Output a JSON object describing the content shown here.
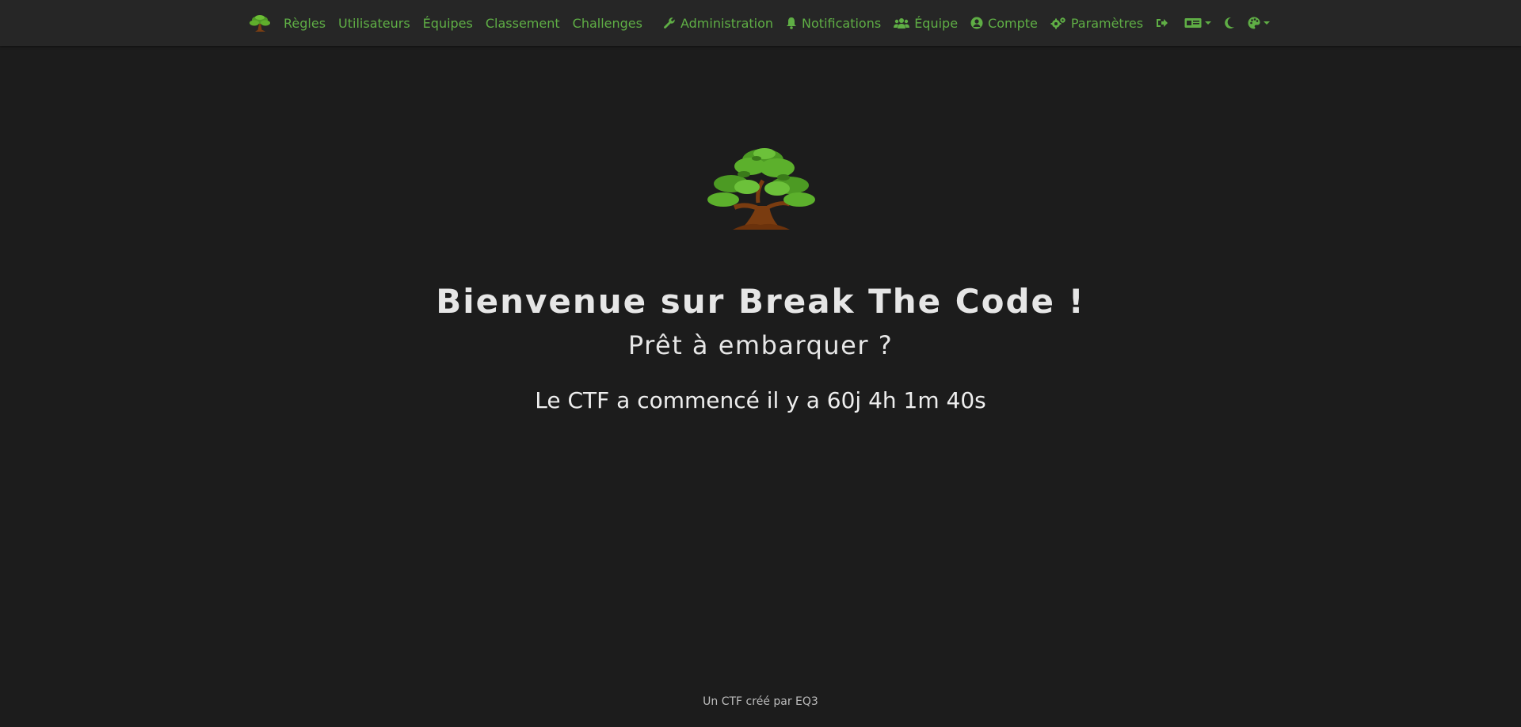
{
  "nav": {
    "left": [
      {
        "label": "Règles"
      },
      {
        "label": "Utilisateurs"
      },
      {
        "label": "Équipes"
      },
      {
        "label": "Classement"
      },
      {
        "label": "Challenges"
      }
    ],
    "right": [
      {
        "label": "Administration",
        "icon": "wrench-icon"
      },
      {
        "label": "Notifications",
        "icon": "bell-icon"
      },
      {
        "label": "Équipe",
        "icon": "users-icon"
      },
      {
        "label": "Compte",
        "icon": "user-circle-icon"
      },
      {
        "label": "Paramètres",
        "icon": "cogs-icon"
      }
    ],
    "icons": [
      "logout-icon",
      "language-icon",
      "moon-icon",
      "palette-icon"
    ]
  },
  "hero": {
    "title": "Bienvenue sur Break The Code !",
    "subtitle": "Prêt à embarquer ?",
    "countdown": "Le CTF a commencé il y a 60j 4h 1m 40s"
  },
  "footer": {
    "text": "Un CTF créé par EQ3"
  },
  "colors": {
    "accent": "#5fae45",
    "background": "#1c1c1c",
    "navbar": "#262626"
  }
}
